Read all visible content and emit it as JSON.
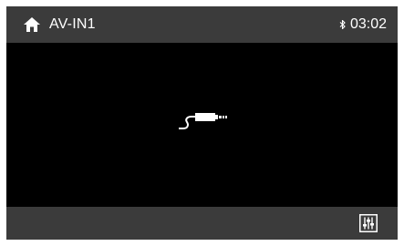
{
  "header": {
    "title": "AV-IN1",
    "time": "03:02",
    "home_icon": "home-icon",
    "bluetooth_icon": "bluetooth-icon"
  },
  "main": {
    "source_icon": "aux-cable-icon"
  },
  "footer": {
    "eq_icon": "equalizer-settings-icon"
  },
  "colors": {
    "bar_background": "#3b3b3b",
    "screen_background": "#000000",
    "text": "#ffffff"
  }
}
